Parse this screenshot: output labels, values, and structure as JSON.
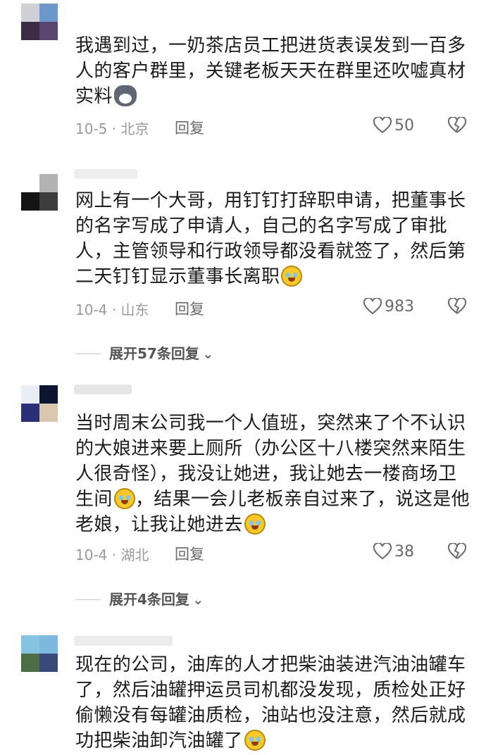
{
  "comments": [
    {
      "text": "我遇到过，一奶茶店员工把进货表误发到一百多人的客户群里，关键老板天天在群里还吹嘘真材实料",
      "emoji": "cat-emoji",
      "meta": "10-5 · 北京",
      "reply_label": "回复",
      "likes": "50"
    },
    {
      "text": "网上有一个大哥，用钉钉打辞职申请，把董事长的名字写成了申请人，自己的名字写成了审批人，主管领导和行政领导都没看就签了，然后第二天钉钉显示董事长离职",
      "emoji": "tears-of-joy-emoji",
      "meta": "10-4 · 山东",
      "reply_label": "回复",
      "likes": "983",
      "expand_label": "展开57条回复"
    },
    {
      "text_part1": "当时周末公司我一个人值班，突然来了个不认识的大娘进来要上厕所（办公区十八楼突然来陌生人很奇怪），我没让她进，我让她去一楼商场卫生间",
      "text_part2": "，结果一会儿老板亲自过来了，说这是他老娘，让我让她进去",
      "emoji": "tears-of-joy-emoji",
      "meta": "10-4 · 湖北",
      "reply_label": "回复",
      "likes": "38",
      "expand_label": "展开4条回复"
    },
    {
      "text": "现在的公司，油库的人才把柴油装进汽油油罐车了，然后油罐押运员司机都没发现，质检处正好偷懒没有每罐油质检，油站也没注意，然后就成功把柴油卸汽油罐了",
      "emoji": "tears-of-joy-emoji"
    }
  ],
  "colors": {
    "text": "#1c1c1c",
    "meta": "#9a9a9a",
    "icon": "#6a6a6a"
  }
}
